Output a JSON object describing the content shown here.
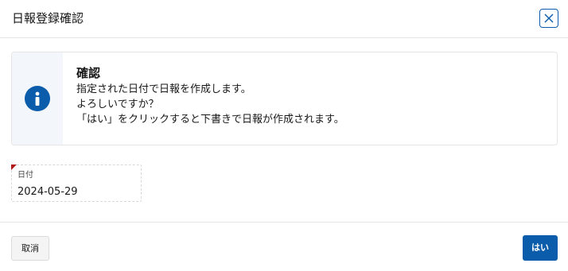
{
  "dialog": {
    "title": "日報登録確認",
    "close_icon": "close-icon"
  },
  "alert": {
    "icon": "info-icon",
    "heading": "確認",
    "lines": [
      "指定された日付で日報を作成します。",
      "よろしいですか？",
      "「はい」をクリックすると下書きで日報が作成されます。"
    ]
  },
  "form": {
    "date_label": "日付",
    "date_value": "2024-05-29",
    "required": true
  },
  "footer": {
    "cancel_label": "取消",
    "yes_label": "はい"
  },
  "colors": {
    "brand": "#0b5cab",
    "required_marker": "#b01818",
    "icon_column_bg": "#f3f7fc"
  }
}
